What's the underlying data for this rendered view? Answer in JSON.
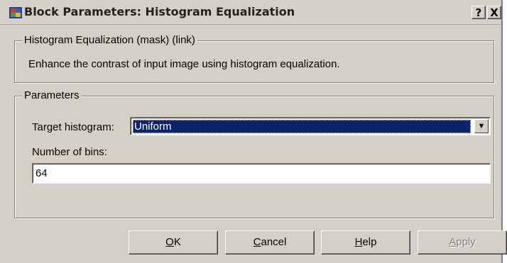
{
  "window": {
    "title": "Block Parameters: Histogram Equalization",
    "help_button": "?",
    "close_button": "X",
    "title_icon": "simulink-block-icon"
  },
  "description_group": {
    "legend": "Histogram Equalization (mask) (link)",
    "text": "Enhance the contrast of input image using histogram equalization."
  },
  "parameters_group": {
    "legend": "Parameters",
    "target_histogram": {
      "label": "Target histogram:",
      "selected": "Uniform",
      "arrow_icon": "chevron-down-icon"
    },
    "number_of_bins": {
      "label": "Number of bins:",
      "value": "64"
    }
  },
  "buttons": {
    "ok": {
      "mnemonic": "O",
      "rest": "K"
    },
    "cancel": {
      "mnemonic": "C",
      "rest": "ancel"
    },
    "help": {
      "mnemonic": "H",
      "rest": "elp"
    },
    "apply": {
      "mnemonic": "A",
      "rest": "pply",
      "enabled": false
    }
  },
  "colors": {
    "dialog_bg": "#d4d0c8",
    "selection_bg": "#0a246a",
    "disabled_text": "#808080"
  }
}
